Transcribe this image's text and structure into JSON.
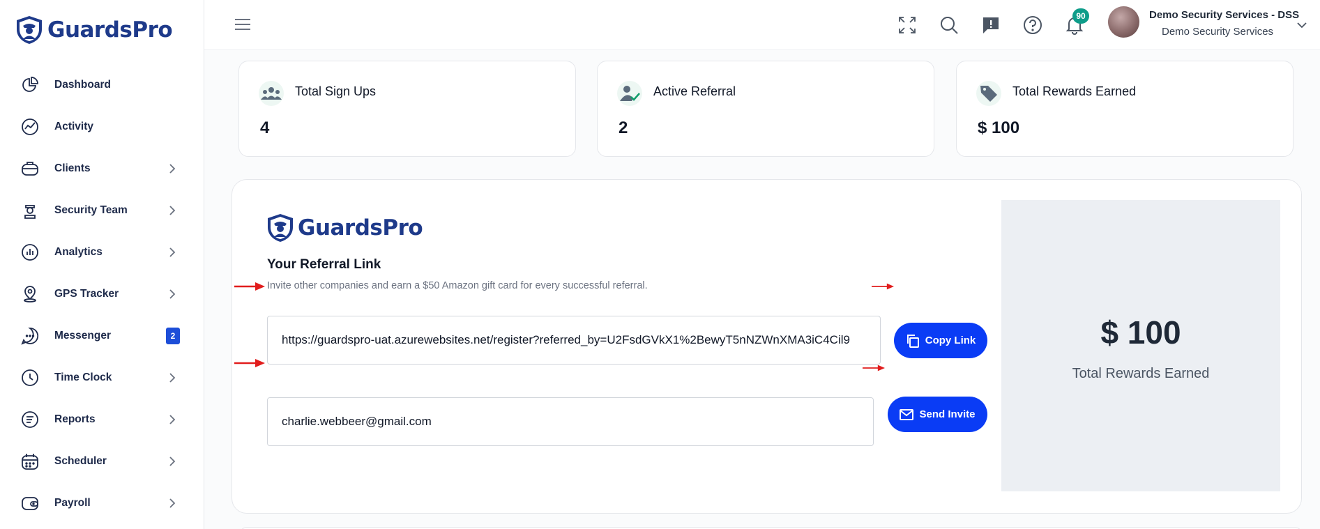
{
  "brand": {
    "name": "GuardsPro",
    "primary_color": "#1e3a8a",
    "button_color": "#0a3cf5",
    "arrow_color": "#e11d1d"
  },
  "sidebar": {
    "items": [
      {
        "label": "Dashboard",
        "icon": "dashboard-icon",
        "chevron": false
      },
      {
        "label": "Activity",
        "icon": "activity-icon",
        "chevron": false
      },
      {
        "label": "Clients",
        "icon": "briefcase-icon",
        "chevron": true
      },
      {
        "label": "Security Team",
        "icon": "guard-icon",
        "chevron": true
      },
      {
        "label": "Analytics",
        "icon": "analytics-icon",
        "chevron": true
      },
      {
        "label": "GPS Tracker",
        "icon": "location-pin-icon",
        "chevron": true
      },
      {
        "label": "Messenger",
        "icon": "chat-icon",
        "badge": "2"
      },
      {
        "label": "Time Clock",
        "icon": "clock-icon",
        "chevron": true
      },
      {
        "label": "Reports",
        "icon": "reports-icon",
        "chevron": true
      },
      {
        "label": "Scheduler",
        "icon": "calendar-icon",
        "chevron": true
      },
      {
        "label": "Payroll",
        "icon": "wallet-icon",
        "chevron": true
      }
    ]
  },
  "header": {
    "notification_count": "90",
    "user_name": "Demo Security Services - DSS",
    "user_org": "Demo Security Services"
  },
  "stats": [
    {
      "title": "Total Sign Ups",
      "value": "4",
      "icon": "users-icon"
    },
    {
      "title": "Active Referral",
      "value": "2",
      "icon": "user-check-icon"
    },
    {
      "title": "Total Rewards Earned",
      "value": "$ 100",
      "icon": "tag-icon"
    }
  ],
  "referral": {
    "title": "Your Referral Link",
    "description": "Invite other companies and earn a $50 Amazon gift card for every successful referral.",
    "link_value": "https://guardspro-uat.azurewebsites.net/register?referred_by=U2FsdGVkX1%2BewyT5nNZWnXMA3iC4Cil9",
    "copy_button": "Copy Link",
    "email_value": "charlie.webbeer@gmail.com",
    "send_button": "Send Invite",
    "reward_amount": "$ 100",
    "reward_label": "Total Rewards Earned"
  }
}
